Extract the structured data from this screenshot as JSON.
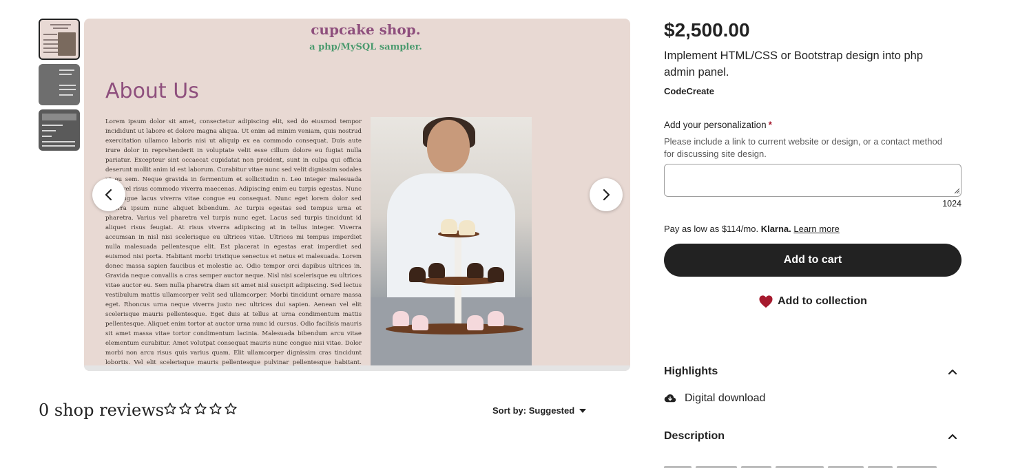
{
  "listing": {
    "price": "$2,500.00",
    "title": "Implement HTML/CSS or Bootstrap design into php admin panel.",
    "shop_name": "CodeCreate"
  },
  "gallery": {
    "image_title": "cupcake shop.",
    "image_subtitle": "a php/MySQL sampler.",
    "about_heading": "About Us",
    "body_text": "Lorem ipsum dolor sit amet, consectetur adipiscing elit, sed do eiusmod tempor incididunt ut labore et dolore magna aliqua. Ut enim ad minim veniam, quis nostrud exercitation ullamco laboris nisi ut aliquip ex ea commodo consequat. Duis aute irure dolor in reprehenderit in voluptate velit esse cillum dolore eu fugiat nulla pariatur. Excepteur sint occaecat cupidatat non proident, sunt in culpa qui officia deserunt mollit anim id est laborum. Curabitur vitae nunc sed velit dignissim sodales ut eu sem. Neque gravida in fermentum et sollicitudin n. Leo integer malesuada nunc vel risus commodo viverra maecenas. Adipiscing enim eu turpis egestas. Nunc sed augue lacus viverra vitae congue eu consequat. Nunc eget lorem dolor sed viverra ipsum nunc aliquet bibendum. Ac turpis egestas sed tempus urna et pharetra. Varius vel pharetra vel turpis nunc eget. Lacus sed turpis tincidunt id aliquet risus feugiat. At risus viverra adipiscing at in tellus integer. Viverra accumsan in nisl nisi scelerisque eu ultrices vitae. Ultrices mi tempus imperdiet nulla malesuada pellentesque elit. Est placerat in egestas erat imperdiet sed euismod nisi porta. Habitant morbi tristique senectus et netus et malesuada. Lorem donec massa sapien faucibus et molestie ac. Odio tempor orci dapibus ultrices in. Gravida neque convallis a cras semper auctor neque. Nisl nisi scelerisque eu ultrices vitae auctor eu. Sem nulla pharetra diam sit amet nisl suscipit adipiscing. Sed lectus vestibulum mattis ullamcorper velit sed ullamcorper. Morbi tincidunt ornare massa eget. Rhoncus urna neque viverra justo nec ultrices dui sapien. Aenean vel elit scelerisque mauris pellentesque. Eget duis at tellus at urna condimentum mattis pellentesque. Aliquet enim tortor at auctor urna nunc id cursus. Odio facilisis mauris sit amet massa vitae tortor condimentum lacinia. Malesuada bibendum arcu vitae elementum curabitur. Amet volutpat consequat mauris nunc congue nisi vitae. Dolor morbi non arcu risus quis varius quam. Elit ullamcorper dignissim cras tincidunt lobortis. Vel elit scelerisque mauris pellentesque pulvinar pellentesque habitant. Netus et malesuada fames ac turpis egestas sed. Id aliquet lectus proin nibh nisl. Erat nulla facilisi etiam dignissim diam quis. Tortor posuere ac ut."
  },
  "personalization": {
    "label": "Add your personalization",
    "required_mark": "*",
    "help": "Please include a link to current website or design, or a contact method for discussing site design.",
    "value": "",
    "char_count": "1024"
  },
  "klarna": {
    "prefix": "Pay as low as $114/mo.",
    "brand": "Klarna.",
    "learn_more": "Learn more"
  },
  "actions": {
    "add_to_cart": "Add to cart",
    "add_to_collection": "Add to collection"
  },
  "sections": {
    "highlights": "Highlights",
    "digital_download": "Digital download",
    "description": "Description"
  },
  "reviews": {
    "heading": "0 shop reviews",
    "rating": 0,
    "sort_label": "Sort by: Suggested"
  },
  "colors": {
    "button_dark": "#222222",
    "required": "#a61a2e",
    "heart": "#a61a2e",
    "image_title": "#8e4f7d",
    "image_subtitle": "#4a9a6e"
  }
}
